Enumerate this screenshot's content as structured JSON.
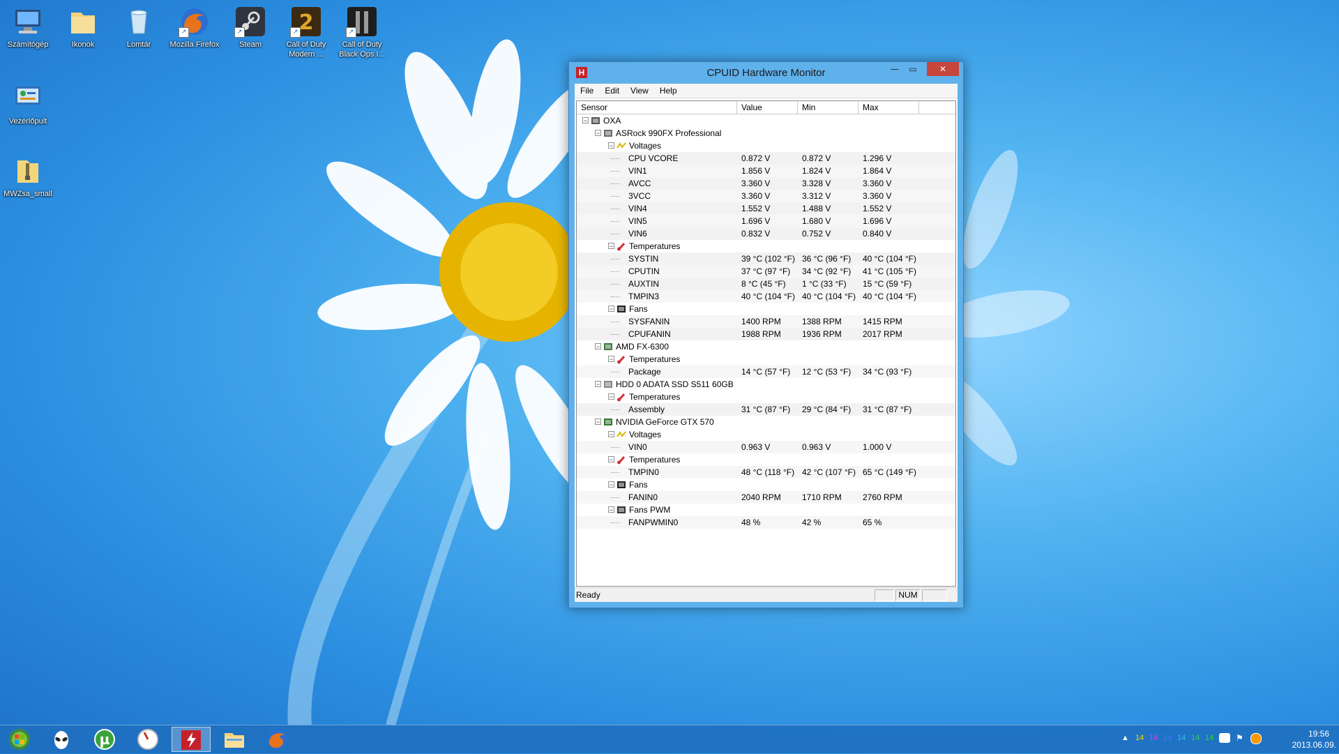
{
  "desktop": {
    "icons": [
      {
        "label": "Számítógép",
        "icon": "computer-icon"
      },
      {
        "label": "Ikonok",
        "icon": "folder-icon"
      },
      {
        "label": "Lomtár",
        "icon": "recycle-bin-icon"
      },
      {
        "label": "Mozilla Firefox",
        "icon": "firefox-icon"
      },
      {
        "label": "Steam",
        "icon": "steam-icon"
      },
      {
        "label": "Call of Duty Modern ...",
        "icon": "cod-mw2-icon"
      },
      {
        "label": "Call of Duty Black Ops I...",
        "icon": "cod-blackops-icon"
      },
      {
        "label": "Vezérlőpult",
        "icon": "control-panel-icon"
      },
      {
        "label": "MWZsa_small",
        "icon": "zip-folder-icon"
      }
    ]
  },
  "window": {
    "title": "CPUID Hardware Monitor",
    "app_icon_letter": "H",
    "controls": {
      "minimize": "—",
      "maximize": "▭",
      "close": "✕"
    },
    "menu": [
      "File",
      "Edit",
      "View",
      "Help"
    ],
    "columns": [
      "Sensor",
      "Value",
      "Min",
      "Max"
    ],
    "status": "Ready",
    "status_num": "NUM",
    "tree": [
      {
        "level": 0,
        "label": "OXA",
        "icon": "computer-icon",
        "expanded": true
      },
      {
        "level": 1,
        "label": "ASRock 990FX Professional",
        "icon": "motherboard-icon",
        "expanded": true
      },
      {
        "level": 2,
        "label": "Voltages",
        "icon": "voltage-icon",
        "expanded": true
      },
      {
        "level": 3,
        "label": "CPU VCORE",
        "value": "0.872 V",
        "min": "0.872 V",
        "max": "1.296 V"
      },
      {
        "level": 3,
        "label": "VIN1",
        "value": "1.856 V",
        "min": "1.824 V",
        "max": "1.864 V"
      },
      {
        "level": 3,
        "label": "AVCC",
        "value": "3.360 V",
        "min": "3.328 V",
        "max": "3.360 V"
      },
      {
        "level": 3,
        "label": "3VCC",
        "value": "3.360 V",
        "min": "3.312 V",
        "max": "3.360 V"
      },
      {
        "level": 3,
        "label": "VIN4",
        "value": "1.552 V",
        "min": "1.488 V",
        "max": "1.552 V"
      },
      {
        "level": 3,
        "label": "VIN5",
        "value": "1.696 V",
        "min": "1.680 V",
        "max": "1.696 V"
      },
      {
        "level": 3,
        "label": "VIN6",
        "value": "0.832 V",
        "min": "0.752 V",
        "max": "0.840 V"
      },
      {
        "level": 2,
        "label": "Temperatures",
        "icon": "thermometer-icon",
        "expanded": true
      },
      {
        "level": 3,
        "label": "SYSTIN",
        "value": "39 °C  (102 °F)",
        "min": "36 °C  (96 °F)",
        "max": "40 °C  (104 °F)"
      },
      {
        "level": 3,
        "label": "CPUTIN",
        "value": "37 °C  (97 °F)",
        "min": "34 °C  (92 °F)",
        "max": "41 °C  (105 °F)"
      },
      {
        "level": 3,
        "label": "AUXTIN",
        "value": "8 °C  (45 °F)",
        "min": "1 °C  (33 °F)",
        "max": "15 °C  (59 °F)"
      },
      {
        "level": 3,
        "label": "TMPIN3",
        "value": "40 °C  (104 °F)",
        "min": "40 °C  (104 °F)",
        "max": "40 °C  (104 °F)"
      },
      {
        "level": 2,
        "label": "Fans",
        "icon": "fan-icon",
        "expanded": true
      },
      {
        "level": 3,
        "label": "SYSFANIN",
        "value": "1400 RPM",
        "min": "1388 RPM",
        "max": "1415 RPM"
      },
      {
        "level": 3,
        "label": "CPUFANIN",
        "value": "1988 RPM",
        "min": "1936 RPM",
        "max": "2017 RPM"
      },
      {
        "level": 1,
        "label": "AMD FX-6300",
        "icon": "cpu-icon",
        "expanded": true
      },
      {
        "level": 2,
        "label": "Temperatures",
        "icon": "thermometer-icon",
        "expanded": true
      },
      {
        "level": 3,
        "label": "Package",
        "value": "14 °C  (57 °F)",
        "min": "12 °C  (53 °F)",
        "max": "34 °C  (93 °F)"
      },
      {
        "level": 1,
        "label": "HDD 0 ADATA SSD S511 60GB",
        "icon": "hdd-icon",
        "expanded": true
      },
      {
        "level": 2,
        "label": "Temperatures",
        "icon": "thermometer-icon",
        "expanded": true
      },
      {
        "level": 3,
        "label": "Assembly",
        "value": "31 °C  (87 °F)",
        "min": "29 °C  (84 °F)",
        "max": "31 °C  (87 °F)"
      },
      {
        "level": 1,
        "label": "NVIDIA GeForce GTX 570",
        "icon": "gpu-icon",
        "expanded": true
      },
      {
        "level": 2,
        "label": "Voltages",
        "icon": "voltage-icon",
        "expanded": true
      },
      {
        "level": 3,
        "label": "VIN0",
        "value": "0.963 V",
        "min": "0.963 V",
        "max": "1.000 V"
      },
      {
        "level": 2,
        "label": "Temperatures",
        "icon": "thermometer-icon",
        "expanded": true
      },
      {
        "level": 3,
        "label": "TMPIN0",
        "value": "48 °C  (118 °F)",
        "min": "42 °C  (107 °F)",
        "max": "65 °C  (149 °F)"
      },
      {
        "level": 2,
        "label": "Fans",
        "icon": "fan-icon",
        "expanded": true
      },
      {
        "level": 3,
        "label": "FANIN0",
        "value": "2040 RPM",
        "min": "1710 RPM",
        "max": "2760 RPM"
      },
      {
        "level": 2,
        "label": "Fans PWM",
        "icon": "fan-pwm-icon",
        "expanded": true
      },
      {
        "level": 3,
        "label": "FANPWMIN0",
        "value": "48 %",
        "min": "42 %",
        "max": "65 %"
      }
    ]
  },
  "taskbar": {
    "buttons": [
      {
        "name": "start-orb",
        "icon": "start-orb-icon"
      },
      {
        "name": "alien-app",
        "icon": "alien-icon"
      },
      {
        "name": "utorrent",
        "icon": "utorrent-icon"
      },
      {
        "name": "clock-app",
        "icon": "gauge-icon"
      },
      {
        "name": "hwmonitor",
        "icon": "hwmonitor-icon",
        "active": true
      },
      {
        "name": "explorer",
        "icon": "folder-icon"
      },
      {
        "name": "firefox",
        "icon": "firefox-icon"
      }
    ],
    "tray_temps": [
      {
        "text": "14",
        "color": "#f5d800"
      },
      {
        "text": "14",
        "color": "#cc44dd"
      },
      {
        "text": "14",
        "color": "#4477ff"
      },
      {
        "text": "14",
        "color": "#33bbee"
      },
      {
        "text": "14",
        "color": "#33cc66"
      },
      {
        "text": "14",
        "color": "#22dd33"
      }
    ],
    "tray_arrow": "▲",
    "clock_time": "19:56",
    "clock_date": "2013.06.09."
  }
}
